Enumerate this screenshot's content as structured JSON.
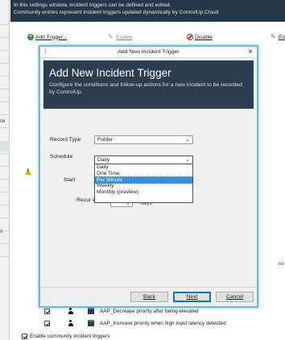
{
  "background": {
    "header_lines": [
      "In this settings window, incident triggers can be defined and edited.",
      "Community entries represent incident triggers updated dynamically by ControlUp.Cloud"
    ],
    "left_pane_label": "ce",
    "left_pane_label_2": "n",
    "toolbar": {
      "add_trigger": "Add Trigger...",
      "enable": "Enable",
      "disable": "Disable",
      "edit": "Ed"
    },
    "right_fragment": "no",
    "rows": [
      {
        "name": "AAP_Decrease priority after being elevated",
        "checked": true
      },
      {
        "name": "AAP_Increase priority when high input latency detected",
        "checked": true
      }
    ],
    "footer_label": "Enable community incident triggers"
  },
  "dialog": {
    "title": "Add New Incident Trigger",
    "close_glyph": "×",
    "app_icon": "⁞⁞",
    "banner": {
      "heading": "Add New Incident Trigger",
      "description": "Configure the conditions and follow-up actions for a new incident to be recorded by ControlUp."
    },
    "record_type": {
      "label": "Record Type",
      "value": "Folder"
    },
    "schedule": {
      "label": "Schedule",
      "value": "Daily",
      "options": [
        "Daily",
        "One Time",
        "Per Minute",
        "Weekly",
        "Monthly (preview)"
      ],
      "highlighted": "Per Minute"
    },
    "start": {
      "label": "Start"
    },
    "recur": {
      "label": "Recur every",
      "unit": "days"
    },
    "buttons": {
      "back": "Back",
      "next": "Next",
      "cancel": "Cancel"
    }
  },
  "colors": {
    "header_bg": "#223849",
    "banner_bg": "#2b3e50",
    "dialog_border": "#5bc1de",
    "focus_border": "#c2185b",
    "highlight": "#3390e6"
  }
}
